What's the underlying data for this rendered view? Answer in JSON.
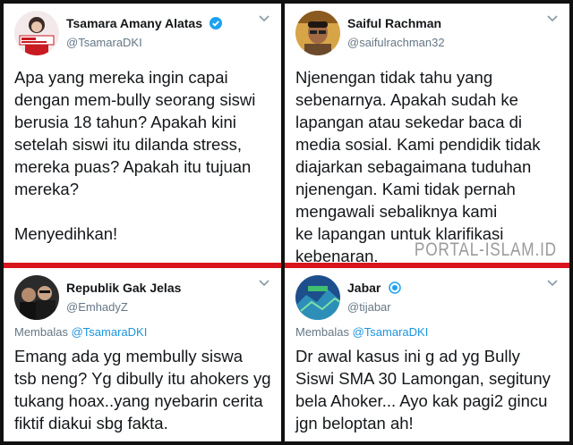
{
  "tweets": [
    {
      "name": "Tsamara Amany Alatas",
      "handle": "@TsamaraDKI",
      "verified": true,
      "body": "Apa yang mereka ingin capai\ndengan mem-bully seorang siswi\nberusia 18 tahun? Apakah kini\nsetelah siswi itu dilanda stress,\nmereka puas? Apakah itu tujuan\nmereka?\n\nMenyedihkan!"
    },
    {
      "name": "Saiful Rachman",
      "handle": "@saifulrachman32",
      "body": "Njenengan tidak tahu yang\nsebenarnya. Apakah sudah ke\nlapangan atau sekedar baca di\nmedia sosial. Kami pendidik tidak\ndiajarkan sebagaimana tuduhan\nnjenengan. Kami tidak pernah\nmengawali sebaliknya kami\nke lapangan  untuk klarifikasi\nkebenaran."
    },
    {
      "name": "Republik Gak Jelas",
      "handle": "@EmhadyZ",
      "reply_prefix": "Membalas",
      "reply_to": "@TsamaraDKI",
      "body": "Emang ada yg membully siswa\ntsb neng? Yg dibully itu ahokers yg\ntukang hoax..yang nyebarin cerita\nfiktif diakui sbg fakta."
    },
    {
      "name": "Jabar",
      "handle": "@tijabar",
      "reply_prefix": "Membalas",
      "reply_to": "@TsamaraDKI",
      "body": "Dr awal kasus ini g ad yg Bully\nSiswi SMA 30 Lamongan, segituny\nbela Ahoker... Ayo kak pagi2 gincu\njgn beloptan ah!"
    }
  ],
  "watermark": "PORTAL-ISLAM.ID",
  "colors": {
    "divider": "#d8141c",
    "verified": "#1da1f2",
    "link": "#1b95e0",
    "muted": "#657786"
  }
}
